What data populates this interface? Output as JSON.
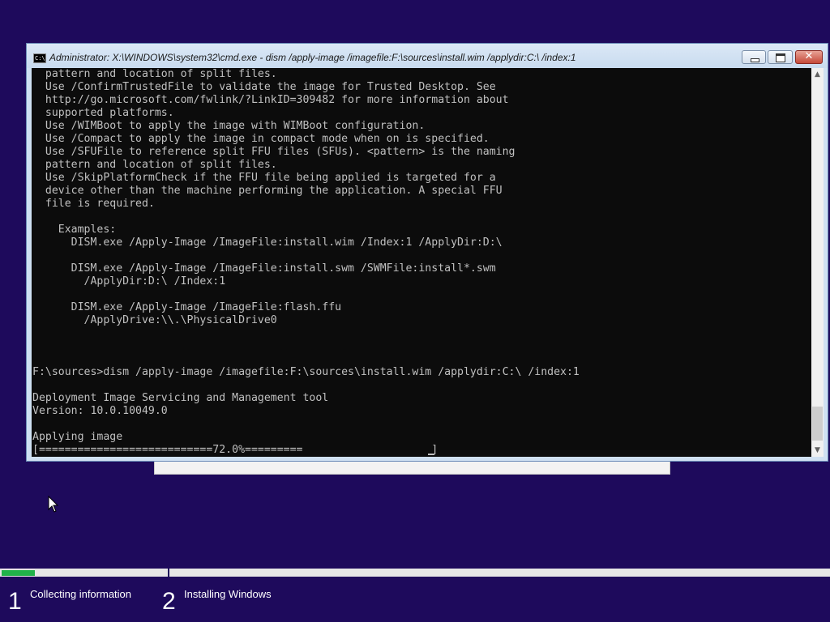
{
  "window": {
    "title": "Administrator: X:\\WINDOWS\\system32\\cmd.exe - dism  /apply-image /imagefile:F:\\sources\\install.wim /applydir:C:\\ /index:1",
    "icon": "cmd-icon",
    "buttons": {
      "minimize": "minimize-icon",
      "maximize": "maximize-icon",
      "close": "close-icon"
    }
  },
  "console": {
    "lines": [
      "  pattern and location of split files.",
      "  Use /ConfirmTrustedFile to validate the image for Trusted Desktop. See",
      "  http://go.microsoft.com/fwlink/?LinkID=309482 for more information about",
      "  supported platforms.",
      "  Use /WIMBoot to apply the image with WIMBoot configuration.",
      "  Use /Compact to apply the image in compact mode when on is specified.",
      "  Use /SFUFile to reference split FFU files (SFUs). <pattern> is the naming",
      "  pattern and location of split files.",
      "  Use /SkipPlatformCheck if the FFU file being applied is targeted for a",
      "  device other than the machine performing the application. A special FFU",
      "  file is required.",
      "",
      "    Examples:",
      "      DISM.exe /Apply-Image /ImageFile:install.wim /Index:1 /ApplyDir:D:\\",
      "",
      "      DISM.exe /Apply-Image /ImageFile:install.swm /SWMFile:install*.swm",
      "        /ApplyDir:D:\\ /Index:1",
      "",
      "      DISM.exe /Apply-Image /ImageFile:flash.ffu",
      "        /ApplyDrive:\\\\.\\PhysicalDrive0",
      "",
      "",
      "",
      "F:\\sources>dism /apply-image /imagefile:F:\\sources\\install.wim /applydir:C:\\ /index:1",
      "",
      "Deployment Image Servicing and Management tool",
      "Version: 10.0.10049.0",
      "",
      "Applying image",
      "[===========================72.0%=========                    ]"
    ],
    "progress_percent": 72.0
  },
  "scrollbar": {
    "up": "scroll-up-arrow-icon",
    "down": "scroll-down-arrow-icon"
  },
  "setup": {
    "steps": [
      {
        "number": "1",
        "label": "Collecting information"
      },
      {
        "number": "2",
        "label": "Installing Windows"
      }
    ],
    "step1_progress": 0.2
  },
  "colors": {
    "background": "#1e0a5c",
    "console_bg": "#0c0c0c",
    "console_text": "#c0c0c0",
    "progress_fill": "#21b24a"
  }
}
